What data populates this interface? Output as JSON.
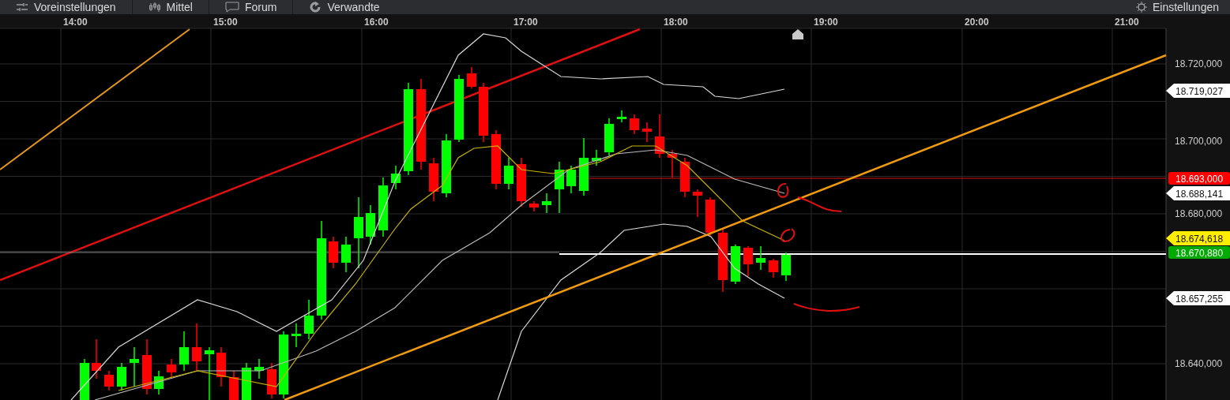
{
  "toolbar": {
    "tabs": [
      {
        "label": "Voreinstellungen"
      },
      {
        "label": "Mittel"
      },
      {
        "label": "Forum"
      },
      {
        "label": "Verwandte"
      }
    ],
    "settings": {
      "label": "Einstellungen"
    }
  },
  "chart": {
    "time_labels": [
      "14:00",
      "15:00",
      "16:00",
      "17:00",
      "18:00",
      "19:00",
      "20:00",
      "21:00"
    ],
    "price_labels": [
      "18.720,000",
      "18.700,000",
      "18.680,000",
      "18.640,000"
    ],
    "price_tags": [
      {
        "text": "18.719,027",
        "kind": "arrow",
        "color": "#ffffff"
      },
      {
        "text": "18.693,000",
        "kind": "box",
        "color": "#ff0000"
      },
      {
        "text": "18.688,141",
        "kind": "arrow",
        "color": "#ffffff"
      },
      {
        "text": "18.674,618",
        "kind": "arrow",
        "color": "#ffee00"
      },
      {
        "text": "18.670,880",
        "kind": "box",
        "color": "#00aa00"
      },
      {
        "text": "18.657,255",
        "kind": "arrow",
        "color": "#ffffff"
      }
    ]
  }
}
